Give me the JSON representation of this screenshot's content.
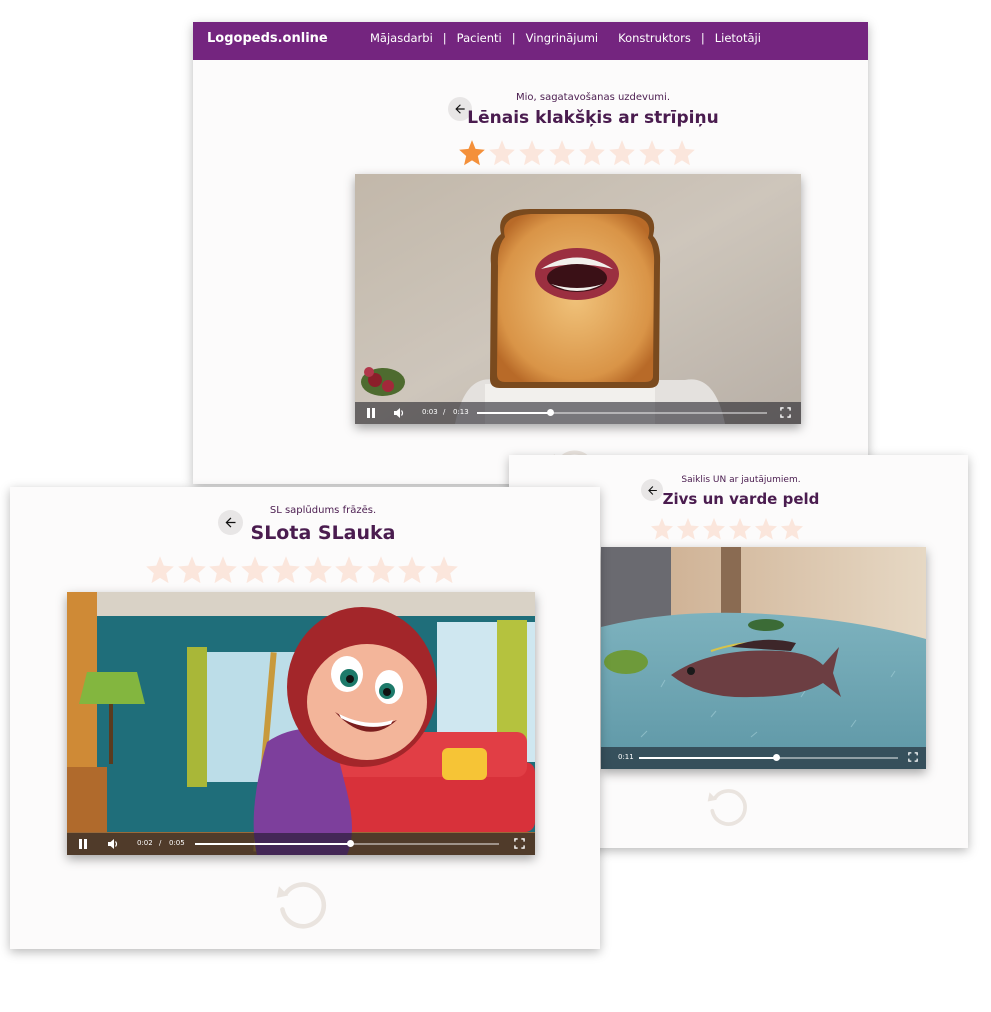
{
  "colors": {
    "brand": "#74257f",
    "title": "#4a1c4f",
    "star_filled": "#f4903a",
    "star_empty": "#fbe6dc",
    "replay": "#eae4df"
  },
  "header": {
    "brand": "Logopeds.online",
    "nav": [
      "Mājasdarbi",
      "|",
      "Pacienti",
      "|",
      "Vingrinājumi",
      "Konstruktors",
      "|",
      "Lietotāji"
    ]
  },
  "main": {
    "subtitle": "Mio, sagatavošanas uzdevumi.",
    "title": "Lēnais klakšķis ar strīpiņu",
    "rating": {
      "filled": 1,
      "total": 8
    },
    "video": {
      "current": "0:03",
      "separator": "/",
      "duration": "0:13",
      "progress": 0.25
    }
  },
  "right": {
    "subtitle": "Saiklis UN ar jautājumiem.",
    "title": "Zivs un varde peld",
    "rating": {
      "filled": 0,
      "total": 6
    },
    "video": {
      "duration": "0:11",
      "progress": 0.53
    }
  },
  "left": {
    "subtitle": "SL saplūdums frāzēs.",
    "title": "SLota SLauka",
    "rating": {
      "filled": 0,
      "total": 10
    },
    "video": {
      "current": "0:02",
      "separator": "/",
      "duration": "0:05",
      "progress": 0.51
    }
  },
  "icons": [
    "back-arrow-icon",
    "star-icon",
    "play-pause-icon",
    "volume-icon",
    "fullscreen-icon",
    "replay-icon"
  ]
}
